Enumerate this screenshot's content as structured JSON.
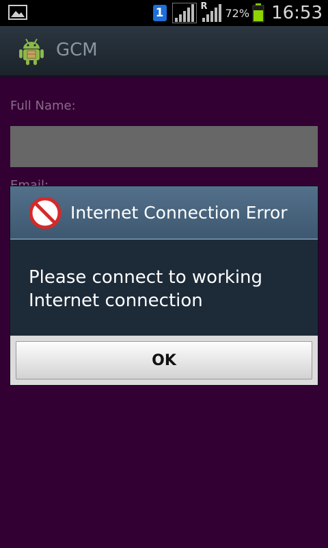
{
  "status_bar": {
    "sim_slot": "1",
    "roaming_indicator": "R",
    "battery_percent": "72%",
    "battery_level": 0.72,
    "time": "16:53",
    "icons": [
      "gallery-icon",
      "sim-icon",
      "signal-icon",
      "roaming-signal-icon",
      "battery-icon"
    ]
  },
  "action_bar": {
    "title": "GCM",
    "icon": "android-icon"
  },
  "form": {
    "full_name_label": "Full Name:",
    "full_name_value": "",
    "email_label": "Email:"
  },
  "dialog": {
    "title": "Internet Connection Error",
    "message": "Please connect to working Internet connection",
    "ok_label": "OK",
    "icon": "no-entry-icon"
  },
  "colors": {
    "background": "#330033",
    "action_bar": "#222c35",
    "dialog_header": "#4a6680",
    "dialog_body": "#1d2a38",
    "battery": "#8fd400",
    "error_red": "#d42a2a"
  }
}
